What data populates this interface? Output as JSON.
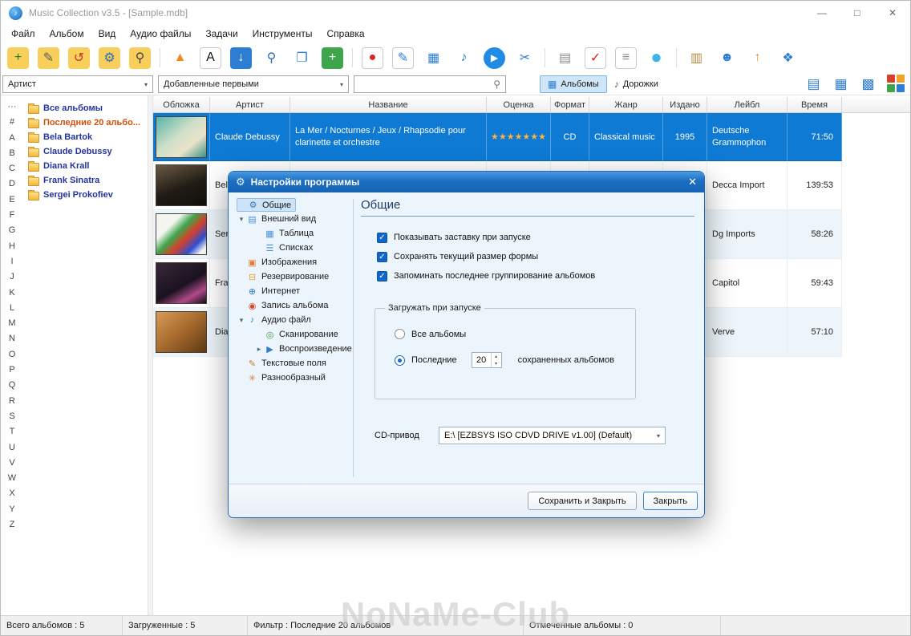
{
  "window": {
    "title": "Music Collection v3.5 - [Sample.mdb]"
  },
  "icons": {
    "note": "♪",
    "minimize": "—",
    "maximize": "□",
    "close": "✕",
    "chevron_down": "▾",
    "search": "⚲",
    "albums_view": "▦",
    "tracks": "♪",
    "gear": "⚙",
    "check": "✓",
    "spin_up": "▴",
    "spin_down": "▾"
  },
  "menu": {
    "items": [
      "Файл",
      "Альбом",
      "Вид",
      "Аудио файлы",
      "Задачи",
      "Инструменты",
      "Справка"
    ]
  },
  "toolbar": {
    "icons": [
      {
        "name": "add-album-icon",
        "glyph": "+",
        "fg": "#1d7a2a",
        "bg": "#f7cf5a",
        "group": 1
      },
      {
        "name": "edit-album-icon",
        "glyph": "✎",
        "fg": "#5a5a5a",
        "bg": "#f7cf5a",
        "group": 1
      },
      {
        "name": "reload-album-icon",
        "glyph": "↺",
        "fg": "#c0392b",
        "bg": "#f7cf5a",
        "group": 1
      },
      {
        "name": "album-settings-icon",
        "glyph": "⚙",
        "fg": "#2d6fb8",
        "bg": "#f7cf5a",
        "group": 1
      },
      {
        "name": "find-album-icon",
        "glyph": "⚲",
        "fg": "#444444",
        "bg": "#f7cf5a",
        "group": 1
      },
      {
        "name": "eject-icon",
        "glyph": "▲",
        "fg": "#f08a1d",
        "group": 2
      },
      {
        "name": "text-tool-icon",
        "glyph": "A",
        "fg": "#111111",
        "bg": "#ffffff",
        "border": true,
        "group": 2
      },
      {
        "name": "import-icon",
        "glyph": "↓",
        "fg": "#ffffff",
        "bg": "#2d7dd2",
        "group": 2
      },
      {
        "name": "search-icon",
        "glyph": "⚲",
        "fg": "#2d6fb8",
        "group": 2
      },
      {
        "name": "browse-folders-icon",
        "glyph": "❐",
        "fg": "#2d7dd2",
        "group": 2
      },
      {
        "name": "add-row-icon",
        "glyph": "+",
        "fg": "#ffffff",
        "bg": "#3fa54a",
        "group": 2
      },
      {
        "name": "record-icon",
        "glyph": "●",
        "fg": "#d8231f",
        "bg": "#ffffff",
        "border": true,
        "group": 3
      },
      {
        "name": "edit-cell-icon",
        "glyph": "✎",
        "fg": "#2d7dd2",
        "bg": "#ffffff",
        "border": true,
        "group": 3
      },
      {
        "name": "search-table-icon",
        "glyph": "▦",
        "fg": "#2d7dd2",
        "group": 3
      },
      {
        "name": "search-audio-icon",
        "glyph": "♪",
        "fg": "#2d7dd2",
        "group": 3
      },
      {
        "name": "play-icon",
        "glyph": "▶",
        "fg": "#ffffff",
        "bg": "#1f8be4",
        "round": true,
        "group": 3
      },
      {
        "name": "crossfade-icon",
        "glyph": "✂",
        "fg": "#2d7dd2",
        "group": 3
      },
      {
        "name": "print-icon",
        "glyph": "▤",
        "fg": "#8a8a8a",
        "group": 4
      },
      {
        "name": "tasks-icon",
        "glyph": "✓",
        "fg": "#d8231f",
        "bg": "#ffffff",
        "border": true,
        "group": 4
      },
      {
        "name": "report-icon",
        "glyph": "≡",
        "fg": "#8a8a8a",
        "bg": "#ffffff",
        "border": true,
        "group": 4
      },
      {
        "name": "disc-icon",
        "glyph": "●",
        "fg": "#3fb3e8",
        "big": true,
        "group": 4
      },
      {
        "name": "archive-icon",
        "glyph": "▥",
        "fg": "#b8863b",
        "group": 5
      },
      {
        "name": "user-icon",
        "glyph": "☻",
        "fg": "#2d7dd2",
        "group": 5
      },
      {
        "name": "upload-icon",
        "glyph": "↑",
        "fg": "#f08a1d",
        "group": 5
      },
      {
        "name": "exit-icon",
        "glyph": "❖",
        "fg": "#2d7dd2",
        "group": 5
      }
    ]
  },
  "filterbar": {
    "field_dropdown": "Артист",
    "sort_dropdown": "Добавленные первыми",
    "search_value": "",
    "view_toggle": [
      {
        "label": "Альбомы",
        "active": true
      },
      {
        "label": "Дорожки",
        "active": false
      }
    ],
    "view_icons": [
      {
        "name": "view-report-icon",
        "glyph": "▤",
        "fg": "#2d7dd2"
      },
      {
        "name": "view-table-icon",
        "glyph": "▦",
        "fg": "#2d7dd2"
      },
      {
        "name": "view-grid-icon",
        "glyph": "▩",
        "fg": "#2d7dd2"
      },
      {
        "name": "view-tiles-icon",
        "quad": [
          "#d8402a",
          "#f0a32a",
          "#3fa54a",
          "#2d7dd2"
        ]
      }
    ]
  },
  "alphabet": [
    "···",
    "#",
    "A",
    "B",
    "C",
    "D",
    "E",
    "F",
    "G",
    "H",
    "I",
    "J",
    "K",
    "L",
    "M",
    "N",
    "O",
    "P",
    "Q",
    "R",
    "S",
    "T",
    "U",
    "V",
    "W",
    "X",
    "Y",
    "Z"
  ],
  "tree": {
    "items": [
      {
        "label": "Все альбомы",
        "color": "#24349c"
      },
      {
        "label": "Последние 20 альбо...",
        "color": "#d1500c"
      },
      {
        "label": "Bela Bartok",
        "color": "#24349c"
      },
      {
        "label": "Claude Debussy",
        "color": "#24349c"
      },
      {
        "label": "Diana Krall",
        "color": "#24349c"
      },
      {
        "label": "Frank Sinatra",
        "color": "#24349c"
      },
      {
        "label": "Sergei Prokofiev",
        "color": "#24349c"
      }
    ]
  },
  "table": {
    "columns": [
      "Обложка",
      "Артист",
      "Название",
      "Оценка",
      "Формат",
      "Жанр",
      "Издано",
      "Лейбл",
      "Время"
    ],
    "rows": [
      {
        "artist": "Claude Debussy",
        "title": "La Mer / Nocturnes / Jeux / Rhapsodie pour clarinette et orchestre",
        "stars": "★★★★★★★",
        "format": "CD",
        "genre": "Classical music",
        "year": "1995",
        "label": "Deutsche Grammophon",
        "time": "71:50"
      },
      {
        "artist": "Bela",
        "label": "Decca Import",
        "time": "139:53"
      },
      {
        "artist": "Serg",
        "label": "Dg Imports",
        "time": "58:26"
      },
      {
        "artist": "Fran",
        "label": "Capitol",
        "time": "59:43"
      },
      {
        "artist": "Diar",
        "label": "Verve",
        "time": "57:10"
      }
    ]
  },
  "dialog": {
    "title": "Настройки программы",
    "tree": [
      {
        "label": "Общие",
        "icon_name": "general-gear-icon",
        "glyph": "⚙",
        "color": "#3a78c2",
        "selected": true,
        "level": 0,
        "arrow": ""
      },
      {
        "label": "Внешний вид",
        "icon_name": "appearance-icon",
        "glyph": "▤",
        "color": "#4a90d9",
        "level": 0,
        "arrow": "down"
      },
      {
        "label": "Таблица",
        "icon_name": "table-icon",
        "glyph": "▦",
        "color": "#4a90d9",
        "level": 1,
        "arrow": ""
      },
      {
        "label": "Списках",
        "icon_name": "list-icon",
        "glyph": "☰",
        "color": "#4a90d9",
        "level": 1,
        "arrow": ""
      },
      {
        "label": "Изображения",
        "icon_name": "images-icon",
        "glyph": "▣",
        "color": "#e07b39",
        "level": 0,
        "arrow": ""
      },
      {
        "label": "Резервирование",
        "icon_name": "backup-icon",
        "glyph": "⊟",
        "color": "#e0a339",
        "level": 0,
        "arrow": ""
      },
      {
        "label": "Интернет",
        "icon_name": "internet-globe-icon",
        "glyph": "⊕",
        "color": "#2d7dd2",
        "level": 0,
        "arrow": ""
      },
      {
        "label": "Запись альбома",
        "icon_name": "burn-disc-icon",
        "glyph": "◉",
        "color": "#d24a2f",
        "level": 0,
        "arrow": ""
      },
      {
        "label": "Аудио файл",
        "icon_name": "audio-file-icon",
        "glyph": "♪",
        "color": "#2d7dd2",
        "level": 0,
        "arrow": "down"
      },
      {
        "label": "Сканирование",
        "icon_name": "scan-icon",
        "glyph": "◎",
        "color": "#3a9e3a",
        "level": 1,
        "arrow": ""
      },
      {
        "label": "Воспроизведение",
        "icon_name": "playback-icon",
        "glyph": "▶",
        "color": "#2d7dd2",
        "level": 1,
        "arrow": "right"
      },
      {
        "label": "Текстовые поля",
        "icon_name": "text-fields-icon",
        "glyph": "✎",
        "color": "#c27b2a",
        "level": 0,
        "arrow": ""
      },
      {
        "label": "Разнообразный",
        "icon_name": "misc-icon",
        "glyph": "✳",
        "color": "#e07b39",
        "level": 0,
        "arrow": ""
      }
    ],
    "panel": {
      "title": "Общие",
      "checkboxes": [
        {
          "label": "Показывать заставку при запуске",
          "checked": true
        },
        {
          "label": "Сохранять текущий размер формы",
          "checked": true
        },
        {
          "label": "Запоминать последнее группирование альбомов",
          "checked": true
        }
      ],
      "groupbox": {
        "title": "Загружать при запуске",
        "radios": [
          {
            "label": "Все альбомы",
            "checked": false
          },
          {
            "label": "Последние",
            "checked": true
          }
        ],
        "spinner_value": "20",
        "spinner_suffix": "сохраненных альбомов"
      },
      "cd_drive": {
        "label": "CD-привод",
        "value": "E:\\ [EZBSYS ISO CDVD DRIVE v1.00]  (Default)"
      }
    },
    "buttons": [
      {
        "label": "Сохранить и Закрыть"
      },
      {
        "label": "Закрыть"
      }
    ]
  },
  "statusbar": {
    "total": "Всего альбомов : 5",
    "loaded": "Загруженные : 5",
    "filter": "Фильтр : Последние 20 альбомов",
    "checked": "Отмеченные альбомы : 0"
  },
  "watermark": "NoNaMe-Club"
}
